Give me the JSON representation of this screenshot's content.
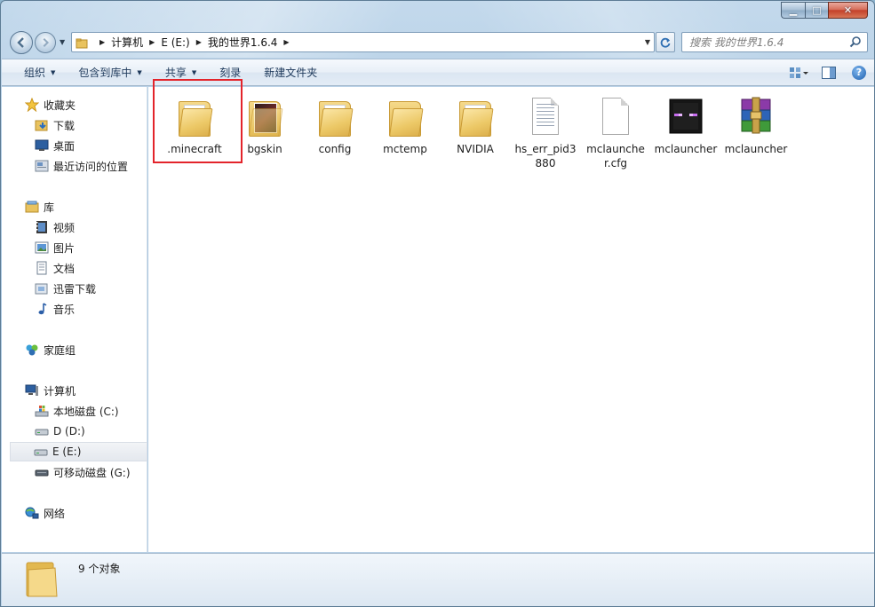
{
  "window": {
    "caption": {
      "minimize": "▁",
      "maximize": "□",
      "close": "✕"
    }
  },
  "address": {
    "crumbs": [
      "计算机",
      "E (E:)",
      "我的世界1.6.4"
    ],
    "search_placeholder": "搜索 我的世界1.6.4"
  },
  "toolbar": {
    "organize": "组织",
    "include_in_library": "包含到库中",
    "share": "共享",
    "burn": "刻录",
    "new_folder": "新建文件夹"
  },
  "sidebar": {
    "favorites": {
      "label": "收藏夹",
      "items": [
        "下载",
        "桌面",
        "最近访问的位置"
      ]
    },
    "libraries": {
      "label": "库",
      "items": [
        "视频",
        "图片",
        "文档",
        "迅雷下载",
        "音乐"
      ]
    },
    "homegroup": {
      "label": "家庭组"
    },
    "computer": {
      "label": "计算机",
      "items": [
        "本地磁盘 (C:)",
        "D (D:)",
        "E (E:)",
        "可移动磁盘 (G:)"
      ]
    },
    "network": {
      "label": "网络"
    }
  },
  "files": [
    {
      "name": ".minecraft",
      "type": "folder"
    },
    {
      "name": "bgskin",
      "type": "folder-photo"
    },
    {
      "name": "config",
      "type": "folder"
    },
    {
      "name": "mctemp",
      "type": "folder"
    },
    {
      "name": "NVIDIA",
      "type": "folder"
    },
    {
      "name": "hs_err_pid3880",
      "type": "text-document"
    },
    {
      "name": "mclauncher.cfg",
      "type": "blank-document"
    },
    {
      "name": "mclauncher",
      "type": "enderman-app"
    },
    {
      "name": "mclauncher",
      "type": "winrar-archive"
    }
  ],
  "status": {
    "count_text": "9 个对象"
  },
  "colors": {
    "highlight": "#e3242b",
    "accent": "#1e395b"
  }
}
